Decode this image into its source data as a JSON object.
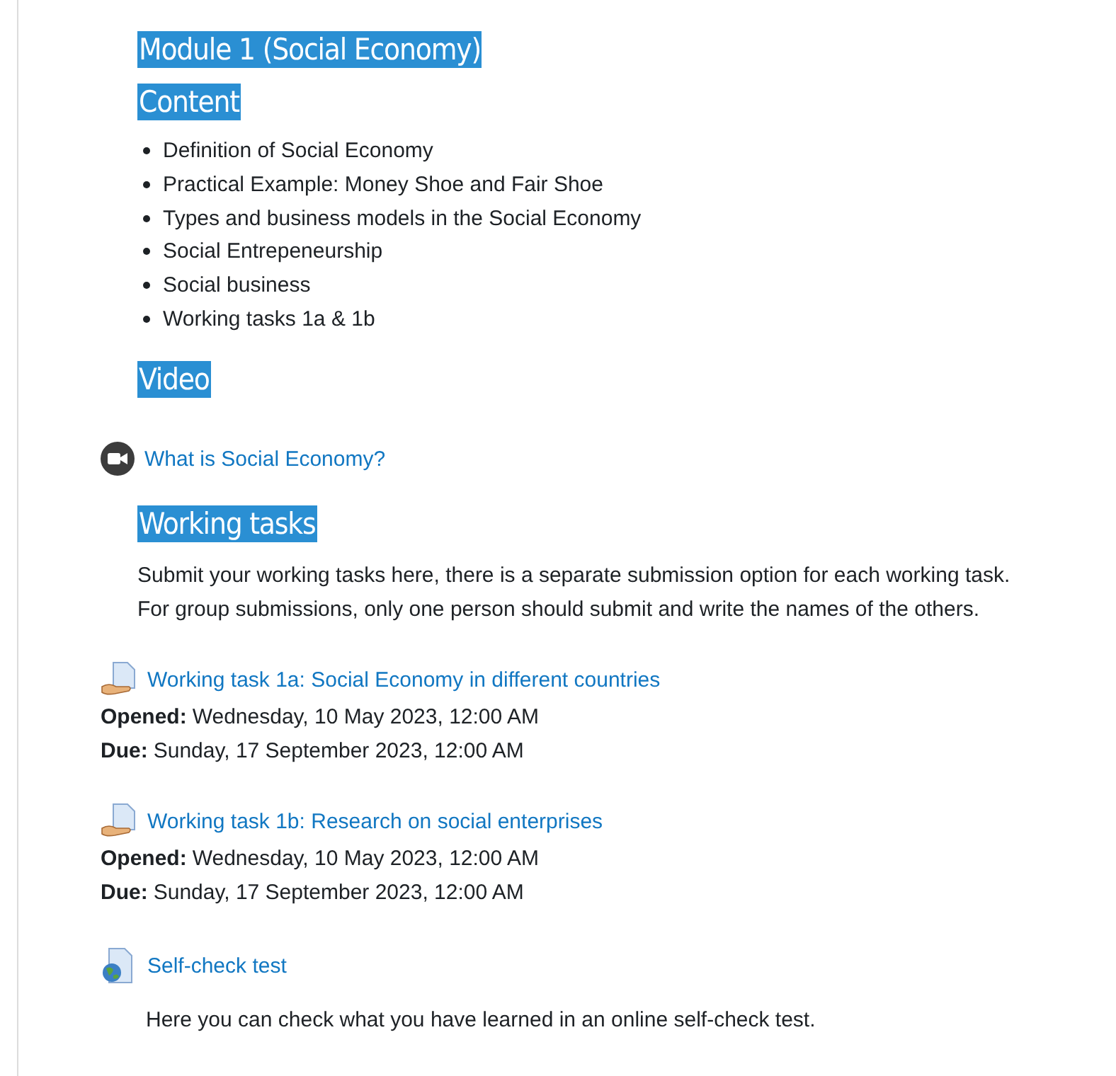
{
  "blocks": [
    {
      "kind": "title",
      "text": "Module 1 (Social Economy)"
    },
    {
      "kind": "heading",
      "text": "Content"
    },
    {
      "kind": "list",
      "items": [
        "Definition of Social Economy",
        "Practical Example: Money Shoe and Fair Shoe",
        "Types and business models in the Social Economy",
        "Social Entrepeneurship",
        "Social business",
        "Working tasks 1a & 1b"
      ]
    },
    {
      "kind": "heading",
      "text": "Video"
    },
    {
      "kind": "video",
      "link": "What is Social Economy?"
    },
    {
      "kind": "heading",
      "text": "Working tasks"
    },
    {
      "kind": "paragraph",
      "lines": [
        "Submit your working tasks here, there is a separate submission option for each working task.",
        "For group submissions, only one person should submit and write the names of the others."
      ]
    },
    {
      "kind": "assignment",
      "link": "Working task 1a: Social Economy in different countries",
      "dates": [
        {
          "label": "Opened:",
          "value": "Wednesday, 10 May 2023, 12:00 AM"
        },
        {
          "label": "Due:",
          "value": "Sunday, 17 September 2023, 12:00 AM"
        }
      ]
    },
    {
      "kind": "assignment",
      "link": "Working task 1b: Research on social enterprises",
      "dates": [
        {
          "label": "Opened:",
          "value": "Wednesday, 10 May 2023, 12:00 AM"
        },
        {
          "label": "Due:",
          "value": "Sunday, 17 September 2023, 12:00 AM"
        }
      ]
    },
    {
      "kind": "quiz",
      "link": "Self-check test",
      "description": "Here you can check what you have learned in an online self-check test."
    }
  ]
}
